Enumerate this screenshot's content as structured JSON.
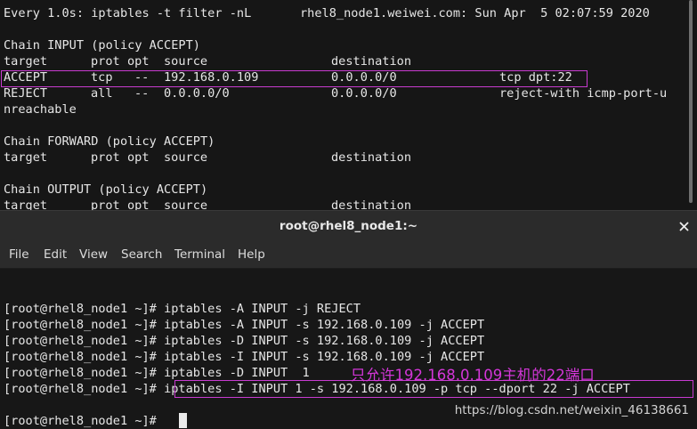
{
  "watch": {
    "header_left": "Every 1.0s: iptables -t filter -nL",
    "header_right": "rhel8_node1.weiwei.com: Sun Apr  5 02:07:59 2020",
    "chains": {
      "input": {
        "title": "Chain INPUT (policy ACCEPT)",
        "columns": [
          "target",
          "prot",
          "opt",
          "source",
          "destination"
        ],
        "rows": [
          {
            "target": "ACCEPT",
            "prot": "tcp",
            "opt": "--",
            "source": "192.168.0.109",
            "destination": "0.0.0.0/0",
            "extra": "tcp dpt:22"
          },
          {
            "target": "REJECT",
            "prot": "all",
            "opt": "--",
            "source": "0.0.0.0/0",
            "destination": "0.0.0.0/0",
            "extra": "reject-with icmp-port-u",
            "wrap": "nreachable"
          }
        ]
      },
      "forward": {
        "title": "Chain FORWARD (policy ACCEPT)",
        "columns": [
          "target",
          "prot",
          "opt",
          "source",
          "destination"
        ]
      },
      "output": {
        "title": "Chain OUTPUT (policy ACCEPT)",
        "columns": [
          "target",
          "prot",
          "opt",
          "source",
          "destination"
        ]
      }
    }
  },
  "terminal": {
    "title": "root@rhel8_node1:~",
    "menu": [
      "File",
      "Edit",
      "View",
      "Search",
      "Terminal",
      "Help"
    ],
    "prompt": "[root@rhel8_node1 ~]#",
    "commands": [
      "iptables -A INPUT -j REJECT",
      "iptables -A INPUT -s 192.168.0.109 -j ACCEPT",
      "iptables -D INPUT -s 192.168.0.109 -j ACCEPT",
      "iptables -I INPUT -s 192.168.0.109 -j ACCEPT",
      "iptables -D INPUT  1",
      "iptables -I INPUT 1 -s 192.168.0.109 -p tcp --dport 22 -j ACCEPT"
    ],
    "annotation": "只允许192.168.0.109主机的22端口"
  },
  "watermark": "https://blog.csdn.net/weixin_46138661",
  "colors": {
    "background": "#171717",
    "text": "#e6e6e6",
    "highlight": "#c83bd0",
    "annotation": "#d336d8",
    "titlebar": "#2b2b2b"
  }
}
